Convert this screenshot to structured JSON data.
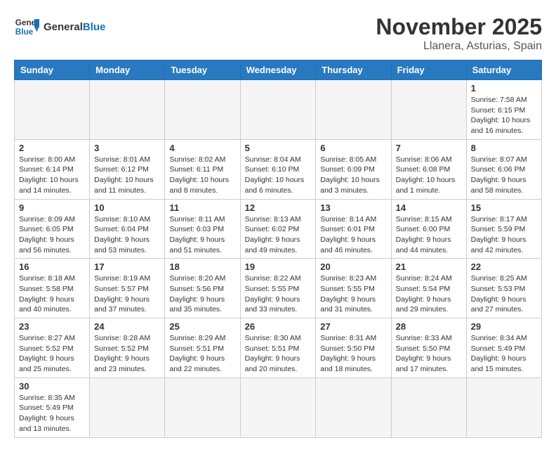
{
  "header": {
    "logo_general": "General",
    "logo_blue": "Blue",
    "month_title": "November 2025",
    "location": "Llanera, Asturias, Spain"
  },
  "weekdays": [
    "Sunday",
    "Monday",
    "Tuesday",
    "Wednesday",
    "Thursday",
    "Friday",
    "Saturday"
  ],
  "weeks": [
    [
      {
        "day": "",
        "info": ""
      },
      {
        "day": "",
        "info": ""
      },
      {
        "day": "",
        "info": ""
      },
      {
        "day": "",
        "info": ""
      },
      {
        "day": "",
        "info": ""
      },
      {
        "day": "",
        "info": ""
      },
      {
        "day": "1",
        "info": "Sunrise: 7:58 AM\nSunset: 6:15 PM\nDaylight: 10 hours and 16 minutes."
      }
    ],
    [
      {
        "day": "2",
        "info": "Sunrise: 8:00 AM\nSunset: 6:14 PM\nDaylight: 10 hours and 14 minutes."
      },
      {
        "day": "3",
        "info": "Sunrise: 8:01 AM\nSunset: 6:12 PM\nDaylight: 10 hours and 11 minutes."
      },
      {
        "day": "4",
        "info": "Sunrise: 8:02 AM\nSunset: 6:11 PM\nDaylight: 10 hours and 8 minutes."
      },
      {
        "day": "5",
        "info": "Sunrise: 8:04 AM\nSunset: 6:10 PM\nDaylight: 10 hours and 6 minutes."
      },
      {
        "day": "6",
        "info": "Sunrise: 8:05 AM\nSunset: 6:09 PM\nDaylight: 10 hours and 3 minutes."
      },
      {
        "day": "7",
        "info": "Sunrise: 8:06 AM\nSunset: 6:08 PM\nDaylight: 10 hours and 1 minute."
      },
      {
        "day": "8",
        "info": "Sunrise: 8:07 AM\nSunset: 6:06 PM\nDaylight: 9 hours and 58 minutes."
      }
    ],
    [
      {
        "day": "9",
        "info": "Sunrise: 8:09 AM\nSunset: 6:05 PM\nDaylight: 9 hours and 56 minutes."
      },
      {
        "day": "10",
        "info": "Sunrise: 8:10 AM\nSunset: 6:04 PM\nDaylight: 9 hours and 53 minutes."
      },
      {
        "day": "11",
        "info": "Sunrise: 8:11 AM\nSunset: 6:03 PM\nDaylight: 9 hours and 51 minutes."
      },
      {
        "day": "12",
        "info": "Sunrise: 8:13 AM\nSunset: 6:02 PM\nDaylight: 9 hours and 49 minutes."
      },
      {
        "day": "13",
        "info": "Sunrise: 8:14 AM\nSunset: 6:01 PM\nDaylight: 9 hours and 46 minutes."
      },
      {
        "day": "14",
        "info": "Sunrise: 8:15 AM\nSunset: 6:00 PM\nDaylight: 9 hours and 44 minutes."
      },
      {
        "day": "15",
        "info": "Sunrise: 8:17 AM\nSunset: 5:59 PM\nDaylight: 9 hours and 42 minutes."
      }
    ],
    [
      {
        "day": "16",
        "info": "Sunrise: 8:18 AM\nSunset: 5:58 PM\nDaylight: 9 hours and 40 minutes."
      },
      {
        "day": "17",
        "info": "Sunrise: 8:19 AM\nSunset: 5:57 PM\nDaylight: 9 hours and 37 minutes."
      },
      {
        "day": "18",
        "info": "Sunrise: 8:20 AM\nSunset: 5:56 PM\nDaylight: 9 hours and 35 minutes."
      },
      {
        "day": "19",
        "info": "Sunrise: 8:22 AM\nSunset: 5:55 PM\nDaylight: 9 hours and 33 minutes."
      },
      {
        "day": "20",
        "info": "Sunrise: 8:23 AM\nSunset: 5:55 PM\nDaylight: 9 hours and 31 minutes."
      },
      {
        "day": "21",
        "info": "Sunrise: 8:24 AM\nSunset: 5:54 PM\nDaylight: 9 hours and 29 minutes."
      },
      {
        "day": "22",
        "info": "Sunrise: 8:25 AM\nSunset: 5:53 PM\nDaylight: 9 hours and 27 minutes."
      }
    ],
    [
      {
        "day": "23",
        "info": "Sunrise: 8:27 AM\nSunset: 5:52 PM\nDaylight: 9 hours and 25 minutes."
      },
      {
        "day": "24",
        "info": "Sunrise: 8:28 AM\nSunset: 5:52 PM\nDaylight: 9 hours and 23 minutes."
      },
      {
        "day": "25",
        "info": "Sunrise: 8:29 AM\nSunset: 5:51 PM\nDaylight: 9 hours and 22 minutes."
      },
      {
        "day": "26",
        "info": "Sunrise: 8:30 AM\nSunset: 5:51 PM\nDaylight: 9 hours and 20 minutes."
      },
      {
        "day": "27",
        "info": "Sunrise: 8:31 AM\nSunset: 5:50 PM\nDaylight: 9 hours and 18 minutes."
      },
      {
        "day": "28",
        "info": "Sunrise: 8:33 AM\nSunset: 5:50 PM\nDaylight: 9 hours and 17 minutes."
      },
      {
        "day": "29",
        "info": "Sunrise: 8:34 AM\nSunset: 5:49 PM\nDaylight: 9 hours and 15 minutes."
      }
    ],
    [
      {
        "day": "30",
        "info": "Sunrise: 8:35 AM\nSunset: 5:49 PM\nDaylight: 9 hours and 13 minutes."
      },
      {
        "day": "",
        "info": ""
      },
      {
        "day": "",
        "info": ""
      },
      {
        "day": "",
        "info": ""
      },
      {
        "day": "",
        "info": ""
      },
      {
        "day": "",
        "info": ""
      },
      {
        "day": "",
        "info": ""
      }
    ]
  ]
}
